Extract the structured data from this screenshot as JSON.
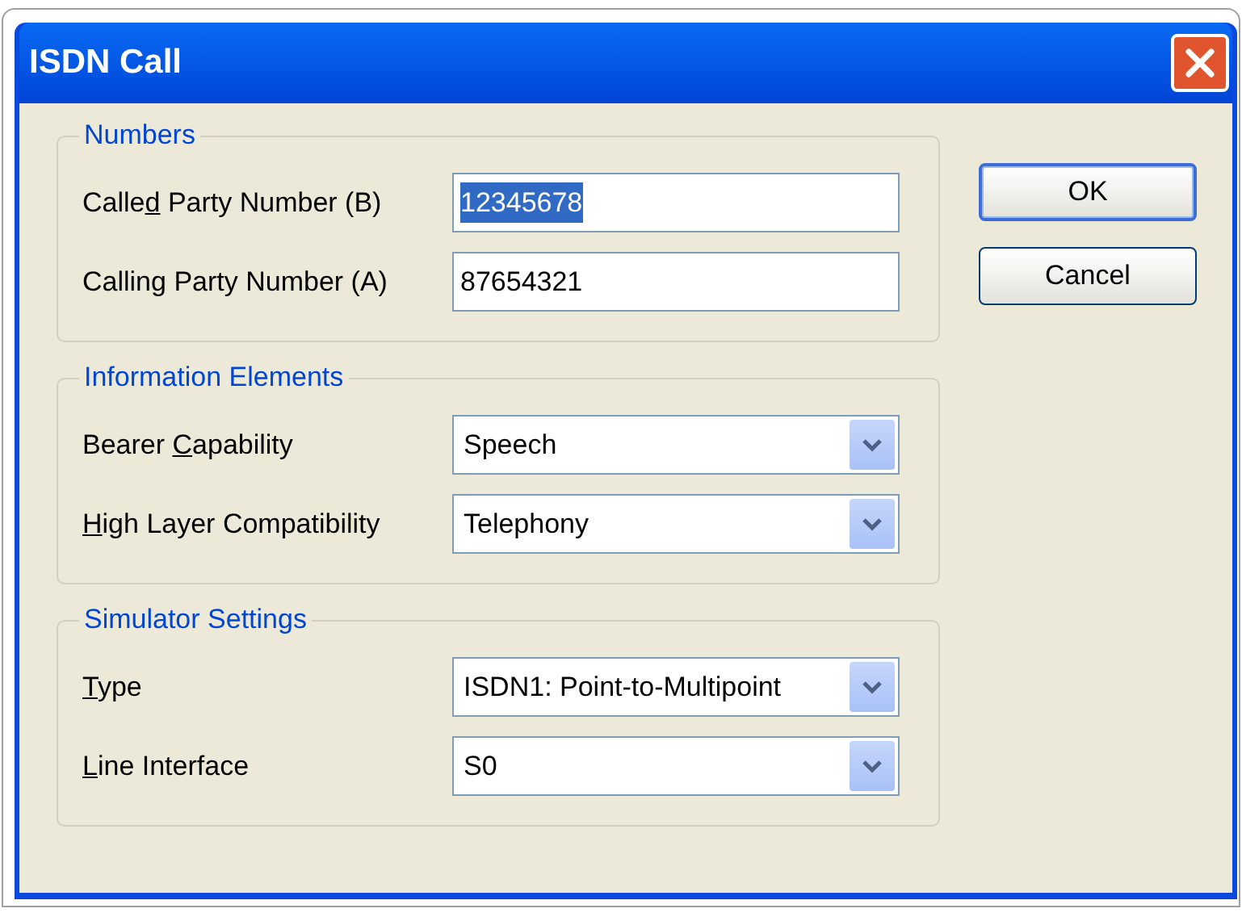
{
  "window": {
    "title": "ISDN Call"
  },
  "groups": [
    {
      "title": "Numbers",
      "rows": [
        {
          "kind": "text",
          "label": {
            "before": "Calle",
            "access_key": "d",
            "after": " Party Number (B)"
          },
          "value": "12345678",
          "text_selected": true
        },
        {
          "kind": "text",
          "label": {
            "before": "Calling Party Number (A)"
          },
          "value": "87654321",
          "text_selected": false
        }
      ]
    },
    {
      "title": "Information Elements",
      "rows": [
        {
          "kind": "dropdown",
          "label": {
            "before": "Bearer ",
            "access_key": "C",
            "after": "apability"
          },
          "value": "Speech"
        },
        {
          "kind": "dropdown",
          "label": {
            "access_key": "H",
            "after": "igh Layer Compatibility"
          },
          "value": "Telephony"
        }
      ]
    },
    {
      "title": "Simulator Settings",
      "rows": [
        {
          "kind": "dropdown",
          "label": {
            "access_key": "T",
            "after": "ype"
          },
          "value": "ISDN1: Point-to-Multipoint"
        },
        {
          "kind": "dropdown",
          "label": {
            "access_key": "L",
            "after": "ine Interface"
          },
          "value": "S0"
        }
      ]
    }
  ],
  "buttons": [
    {
      "label": "OK",
      "default": true
    },
    {
      "label": "Cancel",
      "default": false
    }
  ]
}
